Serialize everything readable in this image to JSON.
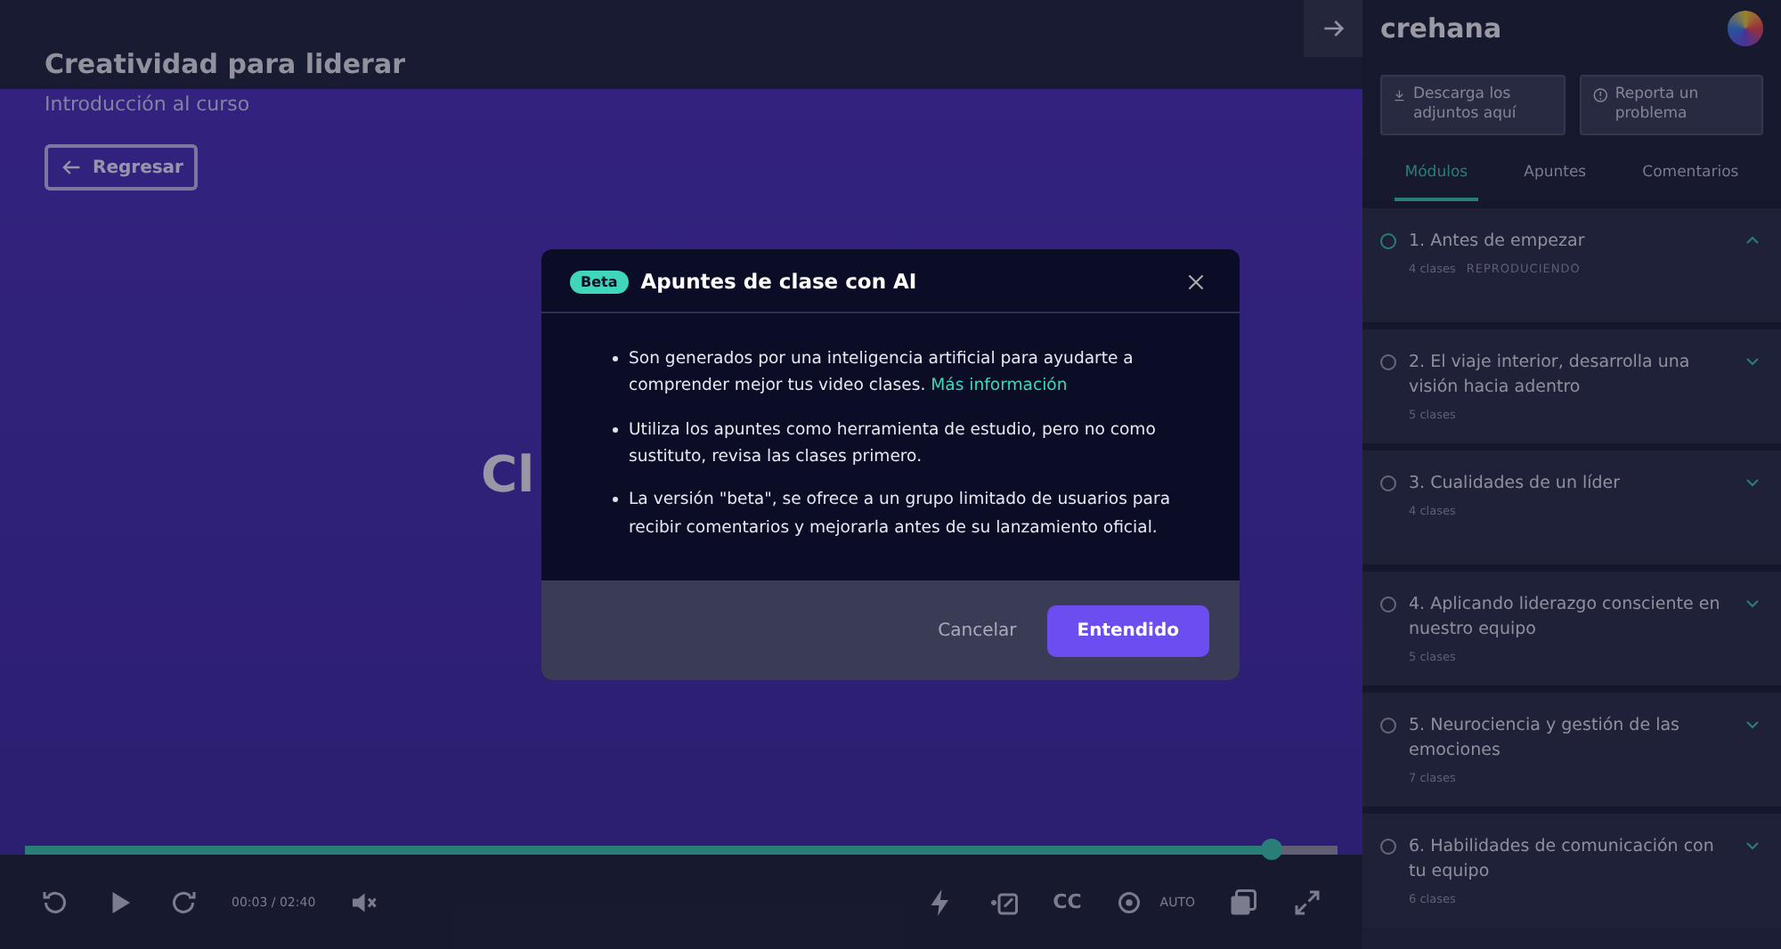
{
  "course": {
    "title": "Creatividad para liderar",
    "subtitle": "Introducción al curso",
    "back_button": "Regresar"
  },
  "video": {
    "title_fragment": "Cl"
  },
  "player": {
    "progress": {
      "level": 0.95
    },
    "time": "00:03 / 02:40",
    "cc": "CC",
    "quality": "AUTO",
    "playing": false
  },
  "sidebar": {
    "logo": "crehana",
    "actions": [
      {
        "kind": "download",
        "label": "Descarga los adjuntos aquí"
      },
      {
        "kind": "report",
        "label": "Reporta un problema"
      }
    ],
    "tabs": [
      {
        "label": "Módulos",
        "selected": true
      },
      {
        "label": "Apuntes",
        "selected": false
      },
      {
        "label": "Comentarios",
        "selected": false
      }
    ],
    "modules": [
      {
        "title": "1. Antes de empezar",
        "meta": "4 clases",
        "status": "REPRODUCIENDO",
        "active": true,
        "expanded": true
      },
      {
        "title": "2. El viaje interior, desarrolla una visión hacia adentro",
        "meta": "5 clases",
        "active": false,
        "expanded": false
      },
      {
        "title": "3. Cualidades de un líder",
        "meta": "4 clases",
        "active": false,
        "expanded": false
      },
      {
        "title": "4. Aplicando liderazgo consciente en nuestro equipo",
        "meta": "5 clases",
        "active": false,
        "expanded": false
      },
      {
        "title": "5. Neurociencia y gestión de las emociones",
        "meta": "7 clases",
        "active": false,
        "expanded": false
      },
      {
        "title": "6. Habilidades de comunicación con tu equipo",
        "meta": "6 clases",
        "active": false,
        "expanded": false
      }
    ]
  },
  "dialog": {
    "badge": "Beta",
    "title": "Apuntes de clase con AI",
    "bullets": [
      {
        "text": "Son generados por una inteligencia artificial para ayudarte a comprender mejor tus video clases.",
        "link": "Más información"
      },
      {
        "text": "Utiliza los apuntes como herramienta de estudio, pero no como sustituto, revisa las clases primero."
      },
      {
        "text": "La versión \"beta\", se ofrece a un grupo limitado de usuarios para recibir comentarios y mejorarla antes de su lanzamiento oficial."
      }
    ],
    "cancel": "Cancelar",
    "confirm": "Entendido"
  }
}
